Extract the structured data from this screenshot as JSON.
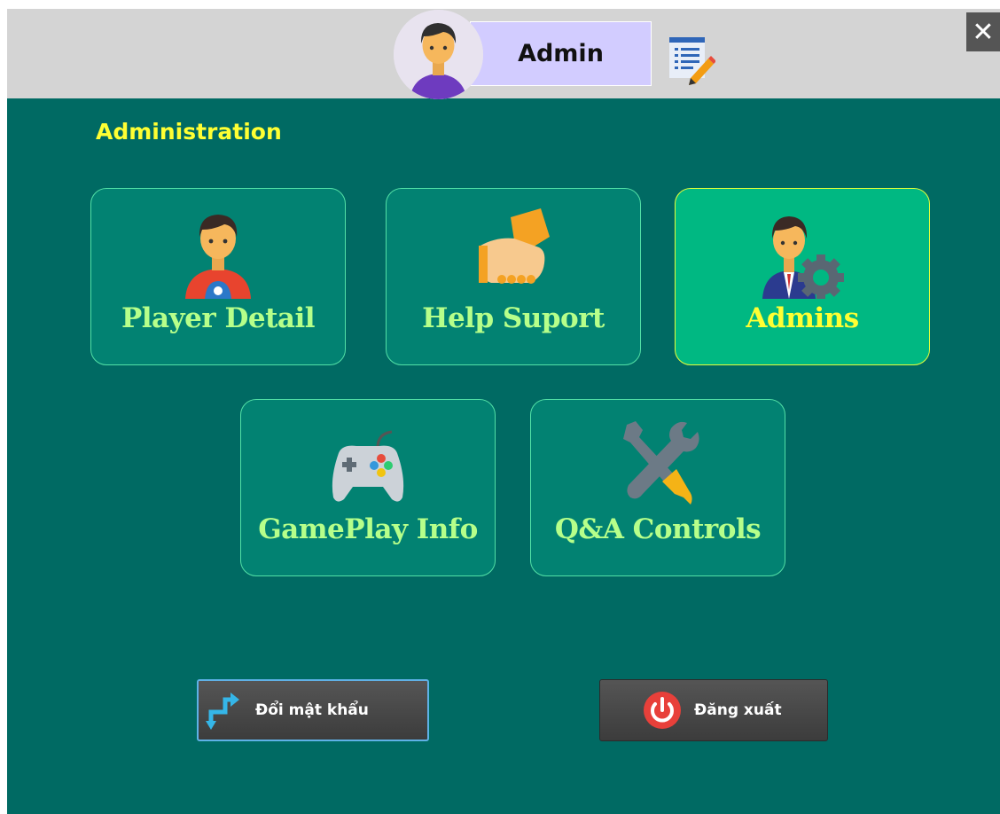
{
  "header": {
    "user_name": "Admin",
    "avatar_icon": "user-avatar-icon",
    "notes_icon": "edit-notes-icon",
    "close_label": "✕"
  },
  "section": {
    "title": "Administration"
  },
  "tiles": [
    {
      "label": "Player Detail",
      "icon": "player-icon",
      "active": false
    },
    {
      "label": "Help Suport",
      "icon": "handshake-icon",
      "active": false
    },
    {
      "label": "Admins",
      "icon": "admin-settings-icon",
      "active": true
    },
    {
      "label": "GamePlay Info",
      "icon": "gamepad-icon",
      "active": false
    },
    {
      "label": "Q&A Controls",
      "icon": "tools-icon",
      "active": false
    }
  ],
  "actions": {
    "change_password_label": "Đổi mật khẩu",
    "logout_label": "Đăng xuất"
  },
  "colors": {
    "background": "#006a63",
    "tile": "#028272",
    "tile_active": "#00b882",
    "tile_label": "#b6ff8a",
    "title": "#ffff33",
    "name_box": "#d2ccff"
  }
}
